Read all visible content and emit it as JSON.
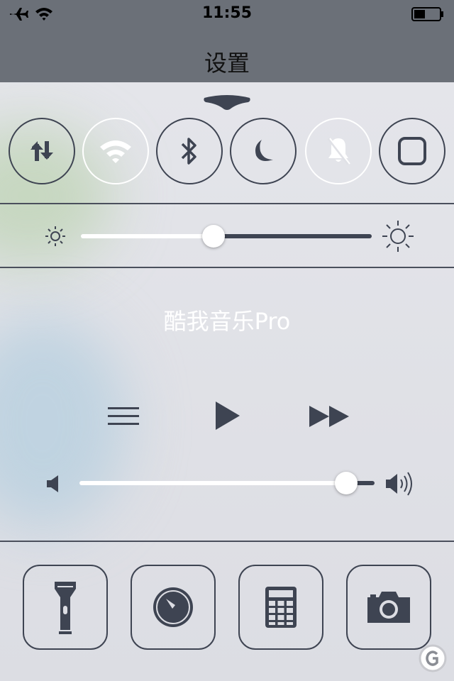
{
  "status_bar": {
    "time": "11:55",
    "icons": [
      "airplane-icon",
      "wifi-icon",
      "battery-icon"
    ]
  },
  "app": {
    "title": "设置"
  },
  "control_center": {
    "toggles": [
      {
        "name": "cellular-data",
        "icon": "cellular-data-icon",
        "active": true
      },
      {
        "name": "wifi",
        "icon": "wifi-icon",
        "active": false
      },
      {
        "name": "bluetooth",
        "icon": "bluetooth-icon",
        "active": true
      },
      {
        "name": "do-not-disturb",
        "icon": "moon-icon",
        "active": true
      },
      {
        "name": "silent",
        "icon": "bell-slash-icon",
        "active": false
      },
      {
        "name": "rotation-lock",
        "icon": "rotation-lock-icon",
        "active": true
      }
    ],
    "brightness": {
      "level": 0.45
    },
    "now_playing": {
      "app_name": "酷我音乐Pro"
    },
    "volume": {
      "level": 0.91
    },
    "shortcuts": [
      {
        "name": "flashlight",
        "icon": "flashlight-icon"
      },
      {
        "name": "timer",
        "icon": "timer-icon"
      },
      {
        "name": "calculator",
        "icon": "calculator-icon"
      },
      {
        "name": "camera",
        "icon": "camera-icon"
      }
    ]
  },
  "colors": {
    "dark_gray": "#3e4452",
    "panel_bg": "#e0e1e6",
    "header_bg": "#6b7078",
    "white": "#ffffff"
  }
}
